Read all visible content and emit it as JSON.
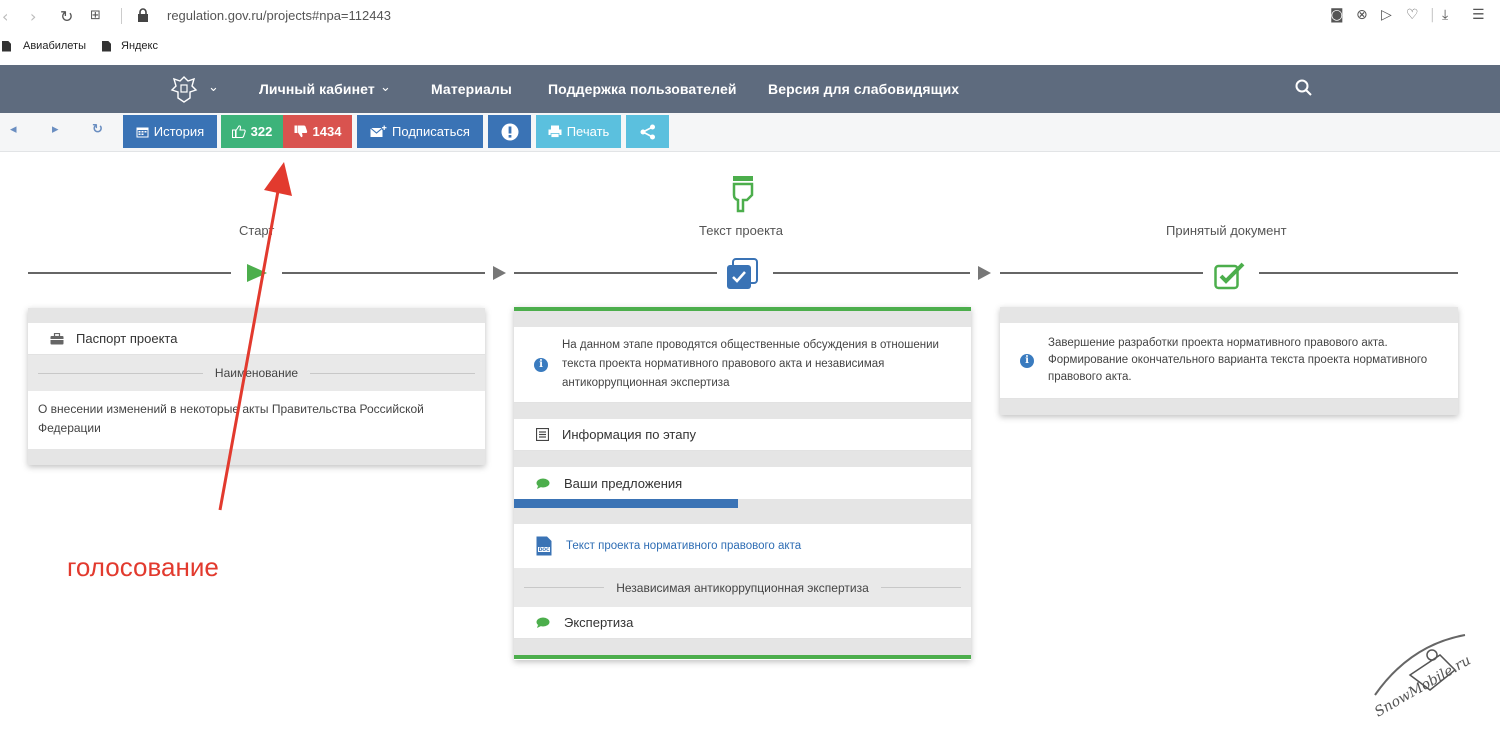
{
  "browser": {
    "url": "regulation.gov.ru/projects#npa=112443",
    "bookmarks": [
      "Авиабилеты",
      "Яндекс"
    ]
  },
  "header": {
    "menu": [
      "Личный кабинет",
      "Материалы",
      "Поддержка пользователей",
      "Версия для слабовидящих"
    ]
  },
  "toolbar": {
    "history_label": "История",
    "likes": "322",
    "dislikes": "1434",
    "subscribe_label": "Подписаться",
    "print_label": "Печать"
  },
  "stages": {
    "start": "Старт",
    "text": "Текст проекта",
    "accepted": "Принятый документ"
  },
  "left_card": {
    "passport_title": "Паспорт проекта",
    "name_label": "Наименование",
    "name_value": "О внесении изменений в некоторые акты Правительства Российской Федерации"
  },
  "middle_card": {
    "info_text": "На данном этапе проводятся общественные обсуждения в отношении текста проекта нормативного правового акта и независимая антикоррупционная экспертиза",
    "stage_info": "Информация по этапу",
    "proposals": "Ваши предложения",
    "proposals_progress": 0.49,
    "doc_link": "Текст проекта нормативного правового акта",
    "expertise_label": "Независимая антикоррупционная экспертиза",
    "expertise": "Экспертиза"
  },
  "right_card": {
    "info_text": "Завершение разработки проекта нормативного правового акта. Формирование окончательного варианта текста проекта нормативного правового акта."
  },
  "annotation": "голосование",
  "colors": {
    "header_bg": "#5e6b7e",
    "history_btn": "#3a73b5",
    "like_btn": "#3db37a",
    "dislike_btn": "#d9534f",
    "subscribe_btn": "#3a73b5",
    "alert_btn": "#3a73b5",
    "print_btn": "#5bc0de",
    "share_btn": "#5bc0de",
    "stage_green": "#4cae4c",
    "annotation_red": "#e23a2e"
  }
}
